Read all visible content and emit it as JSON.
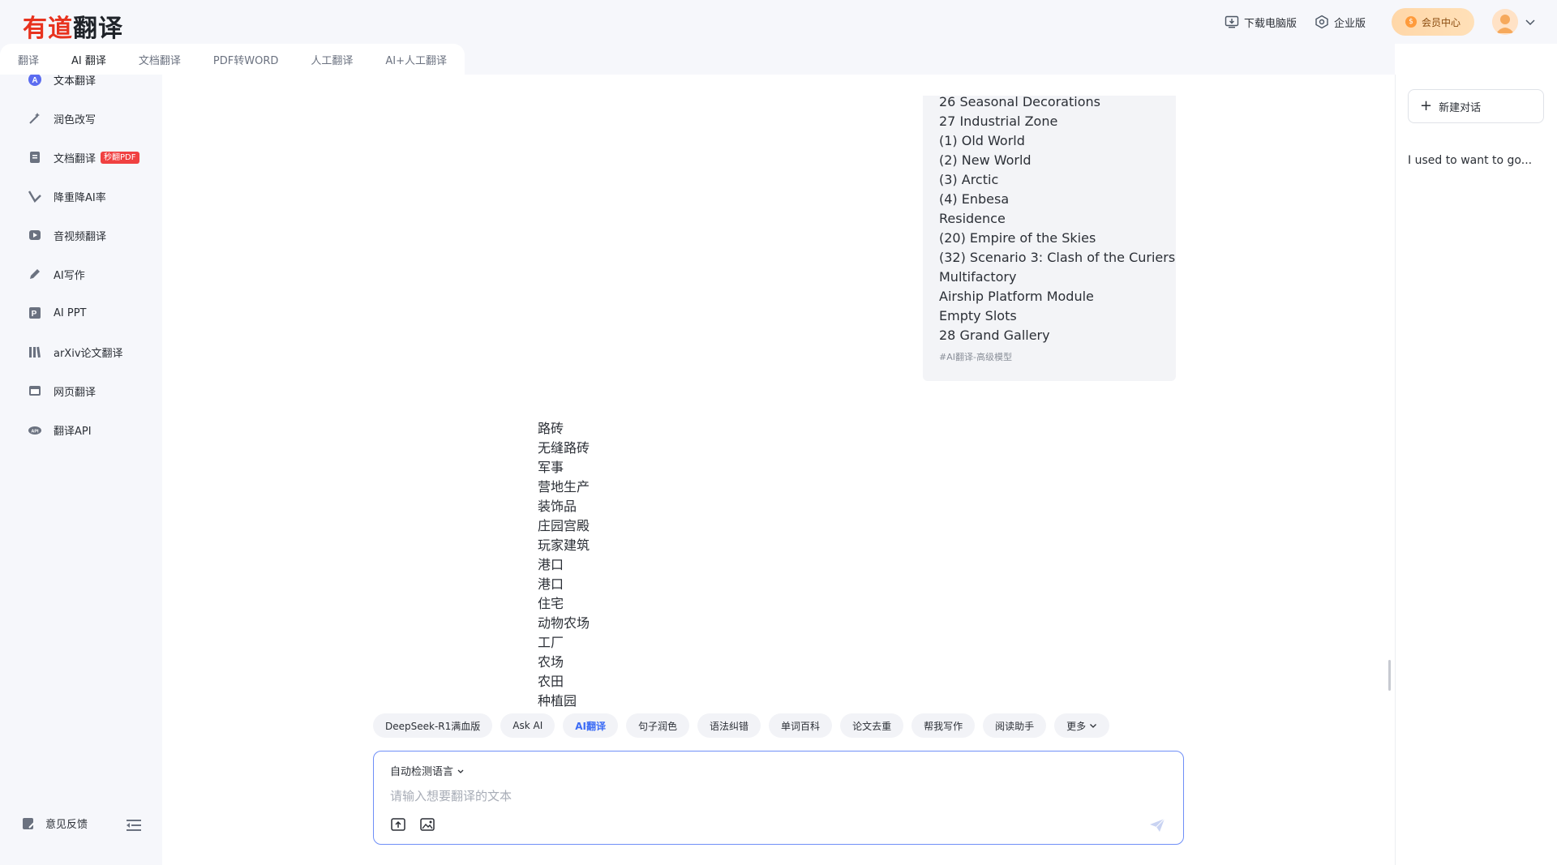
{
  "logo": {
    "part1": "有道",
    "part2": "翻译"
  },
  "sidebar": {
    "items": [
      {
        "label": "文本翻译",
        "icon": "text-translate-icon"
      },
      {
        "label": "润色改写",
        "icon": "magic-wand-icon"
      },
      {
        "label": "文档翻译",
        "icon": "document-icon",
        "badge": "秒翻PDF"
      },
      {
        "label": "降重降AI率",
        "icon": "reduce-icon"
      },
      {
        "label": "音视频翻译",
        "icon": "video-icon"
      },
      {
        "label": "AI写作",
        "icon": "pen-icon"
      },
      {
        "label": "AI PPT",
        "icon": "ppt-icon"
      },
      {
        "label": "arXiv论文翻译",
        "icon": "books-icon"
      },
      {
        "label": "网页翻译",
        "icon": "webpage-icon"
      },
      {
        "label": "翻译API",
        "icon": "api-cloud-icon"
      }
    ],
    "feedback": "意见反馈"
  },
  "topbar": {
    "download": "下载电脑版",
    "enterprise": "企业版",
    "vip": "会员中心"
  },
  "tabs": [
    "翻译",
    "AI 翻译",
    "文档翻译",
    "PDF转WORD",
    "人工翻译",
    "AI+人工翻译"
  ],
  "active_tab": "AI 翻译",
  "conversation": {
    "user_lines": [
      "26 Seasonal Decorations",
      "27 Industrial Zone",
      "(1) Old World",
      "(2) New World",
      "(3) Arctic",
      "(4) Enbesa",
      "Residence",
      "(20) Empire of the Skies",
      "(32) Scenario 3: Clash of the Curiers",
      "Multifactory",
      "Airship Platform Module",
      "Empty Slots",
      "28 Grand Gallery"
    ],
    "user_tag": "#AI翻译-高级模型",
    "ai_lines": [
      "路砖",
      "无缝路砖",
      "军事",
      "营地生产",
      "装饰品",
      "庄园宫殿",
      "玩家建筑",
      "港口",
      "港口",
      "住宅",
      "动物农场",
      "工厂",
      "农场",
      "农田",
      "种植园"
    ]
  },
  "chips": [
    "DeepSeek-R1满血版",
    "Ask AI",
    "AI翻译",
    "句子润色",
    "语法纠错",
    "单词百科",
    "论文去重",
    "帮我写作",
    "阅读助手",
    "更多"
  ],
  "active_chip": "AI翻译",
  "input": {
    "lang": "自动检测语言",
    "placeholder": "请输入想要翻译的文本"
  },
  "right_panel": {
    "new_chat": "新建对话",
    "history": [
      "I used to want to go..."
    ]
  },
  "colors": {
    "accent": "#3b6bf5",
    "brand_red": "#e8321e",
    "pdf_badge": "#f04141",
    "vip_bg": "#ffe0b8"
  }
}
